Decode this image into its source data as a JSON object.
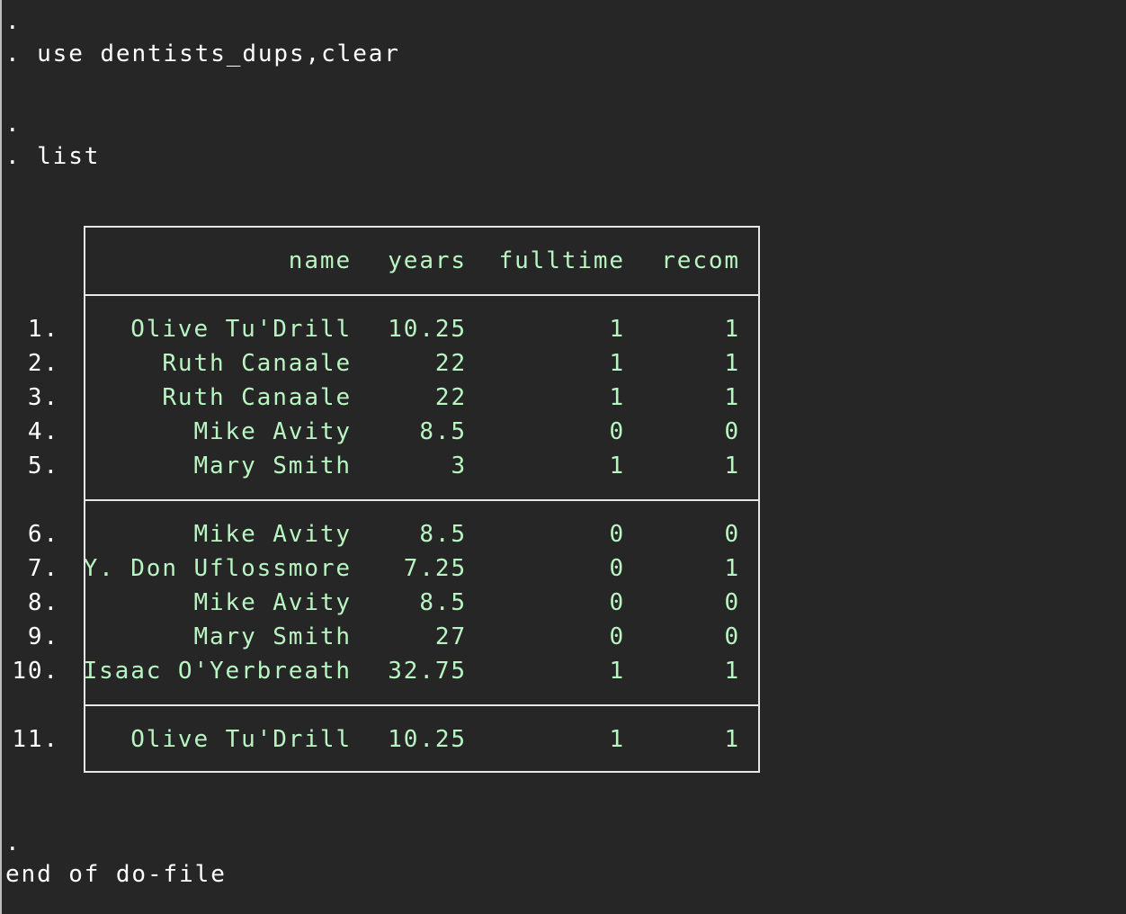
{
  "console": {
    "prompt": ".",
    "cmd_use": "use dentists_dups,clear",
    "cmd_list": "list",
    "end_text": "end of do-file"
  },
  "table": {
    "headers": [
      "name",
      "years",
      "fulltime",
      "recom"
    ],
    "rows": [
      {
        "num": "1.",
        "name": "Olive Tu'Drill",
        "years": "10.25",
        "fulltime": "1",
        "recom": "1"
      },
      {
        "num": "2.",
        "name": "Ruth Canaale",
        "years": "22",
        "fulltime": "1",
        "recom": "1"
      },
      {
        "num": "3.",
        "name": "Ruth Canaale",
        "years": "22",
        "fulltime": "1",
        "recom": "1"
      },
      {
        "num": "4.",
        "name": "Mike Avity",
        "years": "8.5",
        "fulltime": "0",
        "recom": "0"
      },
      {
        "num": "5.",
        "name": "Mary Smith",
        "years": "3",
        "fulltime": "1",
        "recom": "1"
      },
      {
        "num": "6.",
        "name": "Mike Avity",
        "years": "8.5",
        "fulltime": "0",
        "recom": "0"
      },
      {
        "num": "7.",
        "name": "Y. Don Uflossmore",
        "years": "7.25",
        "fulltime": "0",
        "recom": "1"
      },
      {
        "num": "8.",
        "name": "Mike Avity",
        "years": "8.5",
        "fulltime": "0",
        "recom": "0"
      },
      {
        "num": "9.",
        "name": "Mary Smith",
        "years": "27",
        "fulltime": "0",
        "recom": "0"
      },
      {
        "num": "10.",
        "name": "Isaac O'Yerbreath",
        "years": "32.75",
        "fulltime": "1",
        "recom": "1"
      },
      {
        "num": "11.",
        "name": "Olive Tu'Drill",
        "years": "10.25",
        "fulltime": "1",
        "recom": "1"
      }
    ]
  },
  "colors": {
    "background": "#262626",
    "text": "#ffffff",
    "values": "#b9f5c2",
    "border": "#e6e6e6"
  }
}
